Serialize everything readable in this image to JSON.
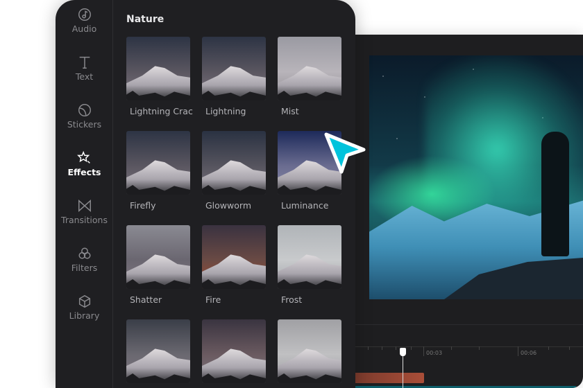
{
  "sidebar": {
    "items": [
      {
        "label": "Audio",
        "icon": "music-note-icon"
      },
      {
        "label": "Text",
        "icon": "text-icon"
      },
      {
        "label": "Stickers",
        "icon": "sticker-icon"
      },
      {
        "label": "Effects",
        "icon": "sparkle-star-icon",
        "active": true
      },
      {
        "label": "Transitions",
        "icon": "bowtie-icon"
      },
      {
        "label": "Filters",
        "icon": "filters-circles-icon"
      },
      {
        "label": "Library",
        "icon": "cube-icon"
      }
    ]
  },
  "effects": {
    "category": "Nature",
    "items": [
      {
        "label": "Lightning Crac"
      },
      {
        "label": "Lightning"
      },
      {
        "label": "Mist"
      },
      {
        "label": "Firefly"
      },
      {
        "label": "Glowworm"
      },
      {
        "label": "Luminance"
      },
      {
        "label": "Shatter"
      },
      {
        "label": "Fire"
      },
      {
        "label": "Frost"
      },
      {
        "label": ""
      },
      {
        "label": ""
      },
      {
        "label": ""
      }
    ]
  },
  "timeline": {
    "ticks": [
      "00:03",
      "00:06"
    ]
  },
  "colors": {
    "accent_cursor": "#00c3dc",
    "clip": "#a94e38",
    "panel": "#1f1f22"
  }
}
